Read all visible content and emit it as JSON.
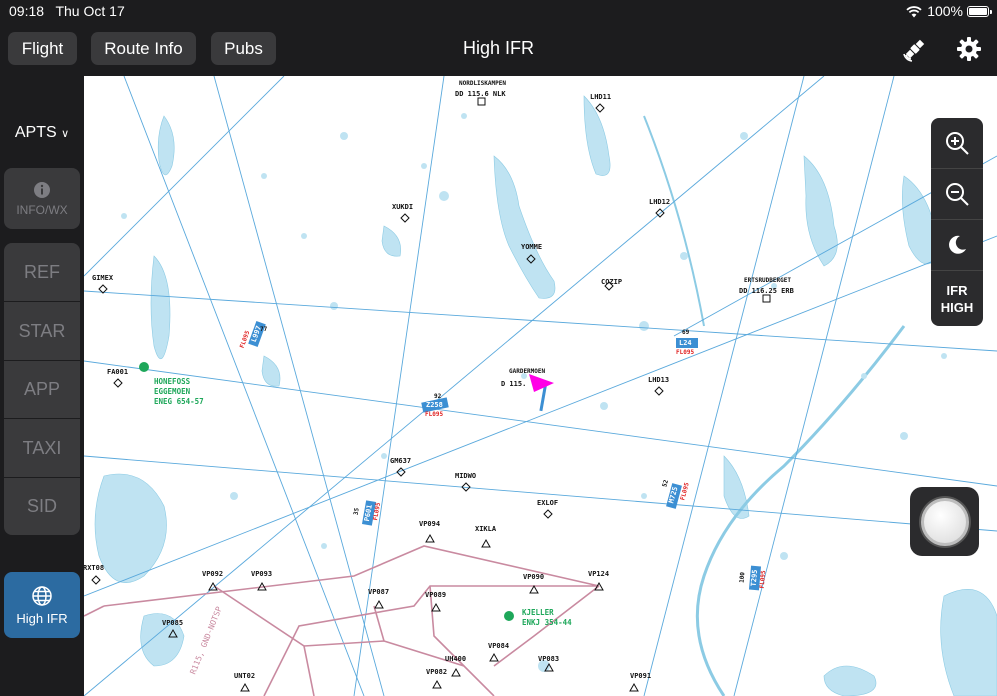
{
  "status": {
    "time": "09:18",
    "date": "Thu Oct 17",
    "battery": "100%"
  },
  "topbar": {
    "flight_label": "Flight",
    "route_label": "Route Info",
    "pubs_label": "Pubs",
    "title": "High IFR",
    "satellite_icon": "satellite-icon",
    "settings_icon": "gear-icon"
  },
  "sidebar": {
    "apts_label": "APTS",
    "info_label": "INFO/WX",
    "items": [
      {
        "label": "REF"
      },
      {
        "label": "STAR"
      },
      {
        "label": "APP"
      },
      {
        "label": "TAXI"
      },
      {
        "label": "SID"
      }
    ],
    "active_label": "High IFR"
  },
  "map_controls": {
    "zoom_in": "zoom-in-icon",
    "zoom_out": "zoom-out-icon",
    "night": "moon-icon",
    "layer_line1": "IFR",
    "layer_line2": "HIGH"
  },
  "map": {
    "fixes": [
      {
        "id": "XUKDI",
        "label": "XUKDI"
      },
      {
        "id": "YOMME",
        "label": "YOMME"
      },
      {
        "id": "COZIP",
        "label": "COZIP"
      },
      {
        "id": "LHD11",
        "label": "LHD11"
      },
      {
        "id": "LHD12",
        "label": "LHD12"
      },
      {
        "id": "LHD13",
        "label": "LHD13"
      },
      {
        "id": "GIMEX",
        "label": "GIMEX"
      },
      {
        "id": "FA001",
        "label": "FA001"
      },
      {
        "id": "GM637",
        "label": "GM637"
      },
      {
        "id": "MIDWO",
        "label": "MIDWO"
      },
      {
        "id": "EXLOF",
        "label": "EXLOF"
      },
      {
        "id": "XIKLA",
        "label": "XIKLA"
      },
      {
        "id": "VP094",
        "label": "VP094"
      },
      {
        "id": "VP092",
        "label": "VP092"
      },
      {
        "id": "VP093",
        "label": "VP093"
      },
      {
        "id": "VP087",
        "label": "VP087"
      },
      {
        "id": "VP089",
        "label": "VP089"
      },
      {
        "id": "VP090",
        "label": "VP090"
      },
      {
        "id": "VP124",
        "label": "VP124"
      },
      {
        "id": "VP085",
        "label": "VP085"
      },
      {
        "id": "VP084",
        "label": "VP084"
      },
      {
        "id": "VP083",
        "label": "VP083"
      },
      {
        "id": "VP082",
        "label": "VP082"
      },
      {
        "id": "UH400",
        "label": "UH400"
      },
      {
        "id": "UNT02",
        "label": "UNT02"
      },
      {
        "id": "VP091",
        "label": "VP091"
      },
      {
        "id": "RXT08",
        "label": "RXT08"
      }
    ],
    "navaids": [
      {
        "name": "NORDLISKAMPEN",
        "freq": "DD 115.6 NLK"
      },
      {
        "name": "ERTSRUDBERGET",
        "freq": "DD 116.25 ERB"
      },
      {
        "name": "GARDERMOEN",
        "freq": "D 115."
      }
    ],
    "airports": [
      {
        "name": "HONEFOSS",
        "line2": "EGGEMOEN",
        "line3": "ENEG  654-57"
      },
      {
        "name": "KJELLER",
        "line2": "ENKJ  354-44"
      }
    ],
    "airways": [
      {
        "label": "L24",
        "alt": "69",
        "fl": "FL095"
      },
      {
        "label": "Z258",
        "alt": "92",
        "fl": "FL095"
      },
      {
        "label": "M725",
        "alt": "52",
        "fl": "FL095"
      },
      {
        "label": "P601",
        "alt": "35",
        "fl": "FL095"
      },
      {
        "label": "L997",
        "alt": "77",
        "fl": "FL095"
      },
      {
        "label": "T295",
        "alt": "100",
        "fl": "FL095"
      }
    ],
    "restricted": "R115, GND-NOTSP",
    "colors": {
      "water": "#bfe3f2",
      "airway": "#5aa9dc",
      "restricted": "#c98aa0",
      "aircraft": "#ff00e6",
      "airport": "#1ea75a"
    }
  }
}
